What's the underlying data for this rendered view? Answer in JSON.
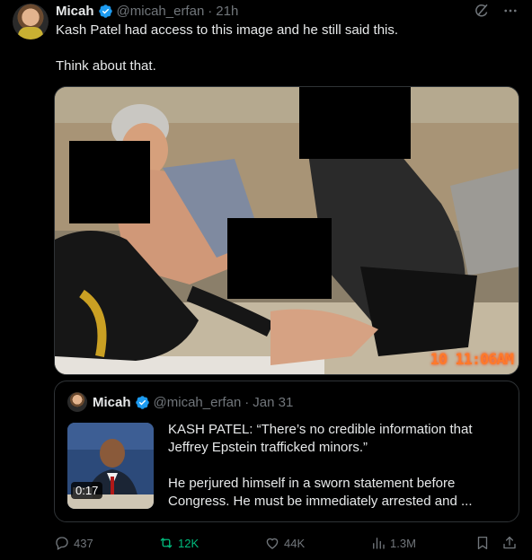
{
  "post": {
    "author_name": "Micah",
    "author_handle": "@micah_erfan",
    "separator": "·",
    "time": "21h",
    "text_line1": "Kash Patel had access to this image and he still said this.",
    "text_line2": "Think about that."
  },
  "media": {
    "timestamp": "10 11:06AM"
  },
  "quote": {
    "author_name": "Micah",
    "author_handle": "@micah_erfan",
    "separator": "·",
    "date": "Jan 31",
    "text_para1": "KASH PATEL: “There’s no credible information that Jeffrey Epstein trafficked minors.”",
    "text_para2": "He perjured himself in a sworn statement before Congress. He must be immediately arrested and ...",
    "video_duration": "0:17"
  },
  "actions": {
    "replies": "437",
    "reposts": "12K",
    "likes": "44K",
    "views": "1.3M"
  },
  "colors": {
    "background": "#000000",
    "text": "#e7e9ea",
    "muted": "#71767b",
    "verified": "#1d9bf0",
    "repost_active": "#00ba7c",
    "border": "#2f3336"
  },
  "icons": [
    "verified-badge-icon",
    "grok-icon",
    "more-icon",
    "reply-icon",
    "repost-icon",
    "like-icon",
    "views-icon",
    "bookmark-icon",
    "share-icon"
  ]
}
